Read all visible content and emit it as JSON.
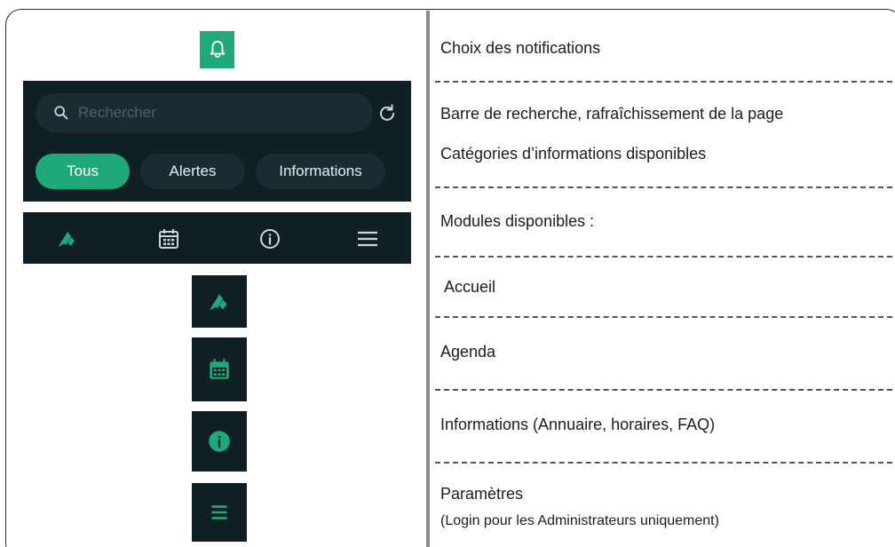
{
  "left": {
    "search": {
      "placeholder": "Rechercher",
      "value": ""
    },
    "filters": [
      {
        "label": "Tous",
        "active": true
      },
      {
        "label": "Alertes",
        "active": false
      },
      {
        "label": "Informations",
        "active": false
      }
    ],
    "nav_icons": [
      "home-icon",
      "calendar-icon",
      "info-icon",
      "menu-icon"
    ],
    "module_tiles": [
      "home-icon",
      "calendar-icon",
      "info-icon",
      "menu-icon"
    ]
  },
  "legend": {
    "notifications": "Choix des notifications",
    "search_refresh": "Barre de recherche, rafraîchissement de la page",
    "categories": "Catégories d’informations disponibles",
    "modules": "Modules disponibles :",
    "home": "Accueil",
    "agenda": "Agenda",
    "info": "Informations (Annuaire, horaires, FAQ)",
    "settings": "Paramètres",
    "settings_note": "(Login pour les Administrateurs uniquement)"
  },
  "colors": {
    "accent": "#1fa97a",
    "panel": "#0f1f24",
    "field": "#1a2c32"
  }
}
